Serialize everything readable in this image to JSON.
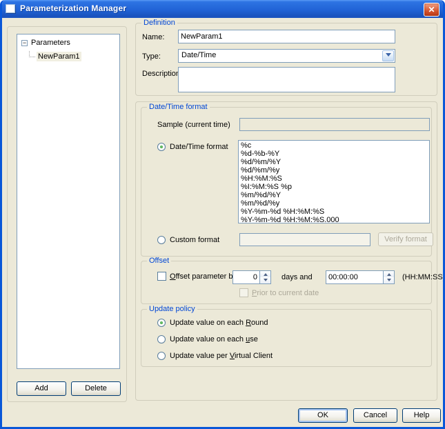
{
  "window": {
    "title": "Parameterization Manager"
  },
  "icons": {
    "close_glyph": "✕",
    "collapse_glyph": "−"
  },
  "colors": {
    "titlebar_blue": "#2E74E3",
    "window_border": "#0A57D8",
    "dialog_bg": "#ECE9D8",
    "group_title_blue": "#0046D5",
    "close_button_red": "#CE4B26",
    "tree_selection": "#F1EFE1"
  },
  "tree": {
    "root_label": "Parameters",
    "child_label": "NewParam1"
  },
  "left_panel": {
    "add_label": "Add",
    "delete_label": "Delete"
  },
  "definition": {
    "title": "Definition",
    "name_label": "Name:",
    "name_value": "NewParam1",
    "type_label": "Type:",
    "type_value": "Date/Time",
    "description_label": "Description",
    "description_value": ""
  },
  "datetime_format": {
    "title": "Date/Time format",
    "sample_label": "Sample (current time)",
    "sample_value": "",
    "datetime_radio_label": "Date/Time format",
    "formats": [
      "%c",
      "%d-%b-%Y",
      "%d/%m/%Y",
      "%d/%m/%y",
      "%H:%M:%S",
      "%I:%M:%S %p",
      "%m/%d/%Y",
      "%m/%d/%y",
      "%Y-%m-%d %H:%M:%S",
      "%Y-%m-%d %H:%M:%S.000"
    ],
    "custom_radio_label": "Custom format",
    "custom_value": "",
    "verify_label": "Verify format"
  },
  "offset": {
    "title": "Offset",
    "offset_label": {
      "key": "O",
      "after": "ffset parameter by"
    },
    "days_value": "0",
    "days_and_label": "days and",
    "time_value": "00:00:00",
    "format_hint": "(HH:MM:SS)",
    "prior_label": {
      "key": "P",
      "after": "rior to current date"
    }
  },
  "update_policy": {
    "title": "Update policy",
    "options": [
      {
        "before": "Update value on each ",
        "key": "R",
        "after": "ound"
      },
      {
        "before": "Update value on each ",
        "key": "u",
        "after": "se"
      },
      {
        "before": "Update value per ",
        "key": "V",
        "after": "irtual Client"
      }
    ]
  },
  "footer": {
    "ok_label": "OK",
    "cancel_label": "Cancel",
    "help_label": "Help"
  }
}
